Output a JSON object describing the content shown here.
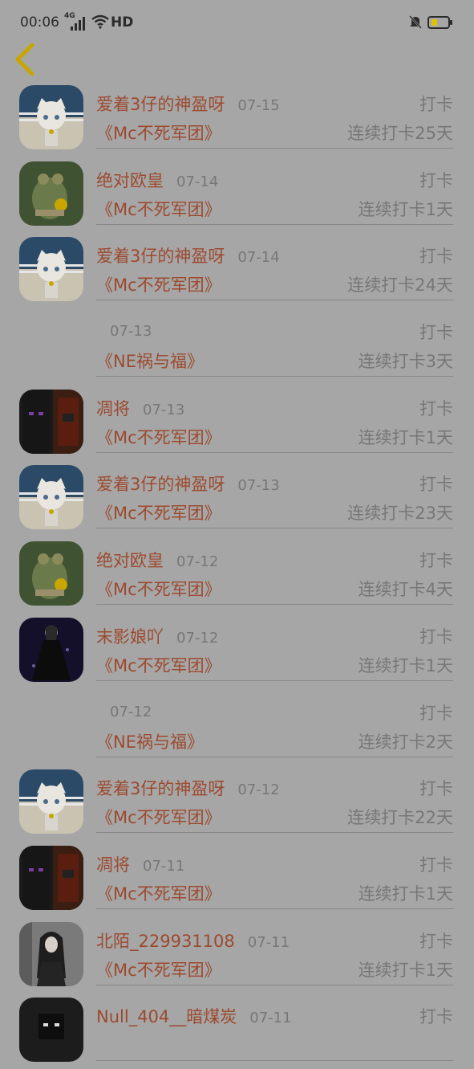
{
  "status_bar": {
    "time": "00:06",
    "network": "4G",
    "hd": "HD",
    "icons": [
      "signal-icon",
      "wifi-icon",
      "mute-icon",
      "battery-icon"
    ],
    "battery_color": "#e0c100"
  },
  "header": {
    "back_icon": "chevron-left-icon",
    "back_color": "#c8a500"
  },
  "colors": {
    "background": "#a6a6a6",
    "name_color": "#9c4a2f",
    "muted_color": "#777777"
  },
  "checkins": [
    {
      "name": "爱着3仔的神盈呀",
      "date": "07-15",
      "group": "《Mc不死军团》",
      "action": "打卡",
      "streak": "连续打卡25天",
      "avatar": "anime-girl-avatar"
    },
    {
      "name": "绝对欧皇",
      "date": "07-14",
      "group": "《Mc不死军团》",
      "action": "打卡",
      "streak": "连续打卡1天",
      "avatar": "frog-avatar"
    },
    {
      "name": "爱着3仔的神盈呀",
      "date": "07-14",
      "group": "《Mc不死军团》",
      "action": "打卡",
      "streak": "连续打卡24天",
      "avatar": "anime-girl-avatar"
    },
    {
      "name": "",
      "date": "07-13",
      "group": "《NE祸与福》",
      "action": "打卡",
      "streak": "连续打卡3天",
      "avatar": ""
    },
    {
      "name": "凋将",
      "date": "07-13",
      "group": "《Mc不死军团》",
      "action": "打卡",
      "streak": "连续打卡1天",
      "avatar": "minecraft-avatar"
    },
    {
      "name": "爱着3仔的神盈呀",
      "date": "07-13",
      "group": "《Mc不死军团》",
      "action": "打卡",
      "streak": "连续打卡23天",
      "avatar": "anime-girl-avatar"
    },
    {
      "name": "绝对欧皇",
      "date": "07-12",
      "group": "《Mc不死军团》",
      "action": "打卡",
      "streak": "连续打卡4天",
      "avatar": "frog-avatar"
    },
    {
      "name": "末影娘吖",
      "date": "07-12",
      "group": "《Mc不死军团》",
      "action": "打卡",
      "streak": "连续打卡1天",
      "avatar": "dark-dress-girl-avatar"
    },
    {
      "name": "",
      "date": "07-12",
      "group": "《NE祸与福》",
      "action": "打卡",
      "streak": "连续打卡2天",
      "avatar": ""
    },
    {
      "name": "爱着3仔的神盈呀",
      "date": "07-12",
      "group": "《Mc不死军团》",
      "action": "打卡",
      "streak": "连续打卡22天",
      "avatar": "anime-girl-avatar"
    },
    {
      "name": "凋将",
      "date": "07-11",
      "group": "《Mc不死军团》",
      "action": "打卡",
      "streak": "连续打卡1天",
      "avatar": "minecraft-avatar"
    },
    {
      "name": "北陌_229931108",
      "date": "07-11",
      "group": "《Mc不死军团》",
      "action": "打卡",
      "streak": "连续打卡1天",
      "avatar": "long-hair-girl-avatar"
    },
    {
      "name": "Null_404__暗煤炭",
      "date": "07-11",
      "group": "",
      "action": "打卡",
      "streak": "",
      "avatar": "dark-avatar"
    }
  ]
}
